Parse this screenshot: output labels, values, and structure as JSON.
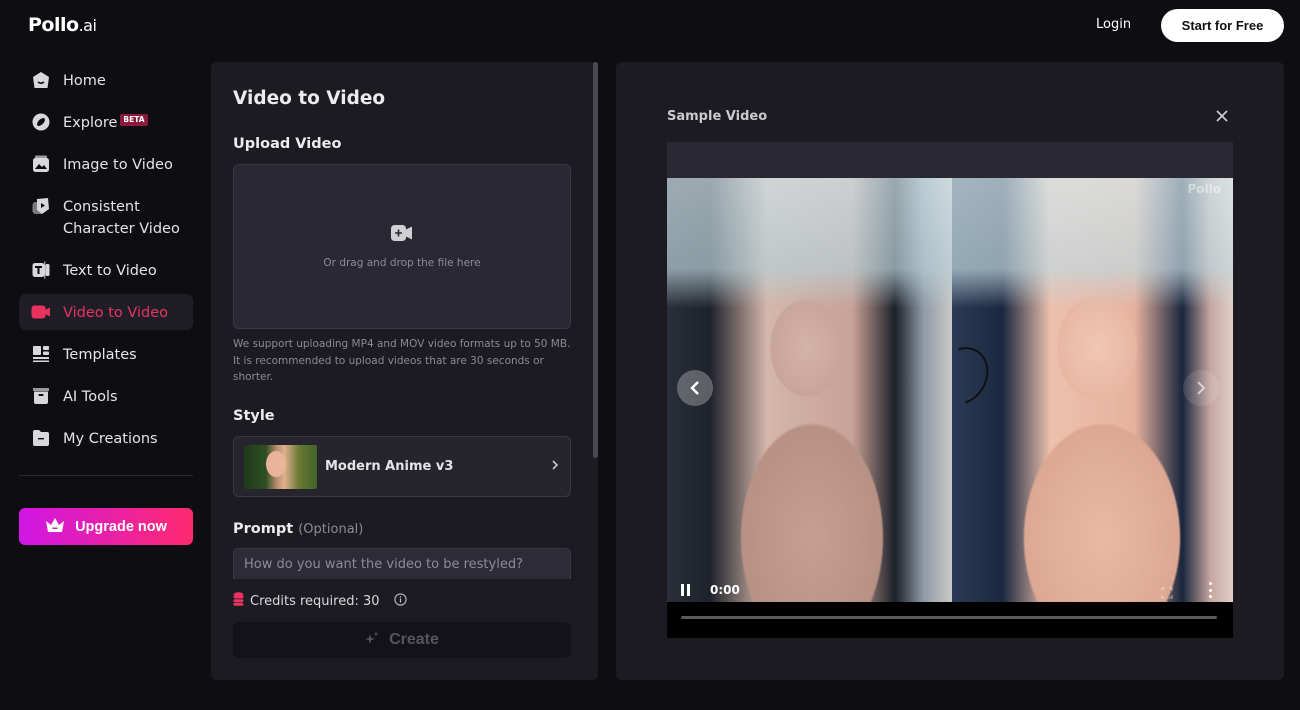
{
  "header": {
    "logo_main": "Pollo",
    "logo_sub": ".ai",
    "login_label": "Login",
    "start_label": "Start for Free"
  },
  "sidebar": {
    "items": [
      {
        "label": "Home",
        "icon": "home-icon"
      },
      {
        "label": "Explore",
        "icon": "compass-icon",
        "badge": "BETA"
      },
      {
        "label": "Image to Video",
        "icon": "image-icon"
      },
      {
        "label": "Consistent Character Video",
        "icon": "character-icon"
      },
      {
        "label": "Text to Video",
        "icon": "text-icon"
      },
      {
        "label": "Video to Video",
        "icon": "video-camera-icon",
        "active": true
      },
      {
        "label": "Templates",
        "icon": "templates-icon"
      },
      {
        "label": "AI Tools",
        "icon": "toolbox-icon"
      },
      {
        "label": "My Creations",
        "icon": "folder-icon"
      }
    ],
    "upgrade_label": "Upgrade now"
  },
  "colors": {
    "accent": "#e8335f",
    "upgrade_gradient_start": "#d016e6",
    "upgrade_gradient_end": "#ff2a6d",
    "background": "#0e0d12",
    "panel": "#1c1b22"
  },
  "main": {
    "title": "Video to Video",
    "upload": {
      "label": "Upload Video",
      "drop_text": "Or drag and drop the file here",
      "note": "We support uploading MP4 and MOV video formats up to 50 MB. It is recommended to upload videos that are 30 seconds or shorter."
    },
    "style": {
      "label": "Style",
      "selected": "Modern Anime v3"
    },
    "prompt": {
      "label": "Prompt",
      "optional": "(Optional)",
      "value": "",
      "placeholder": "How do you want the video to be restyled?"
    },
    "credits_text": "Credits required: 30",
    "create_label": "Create"
  },
  "sample": {
    "title": "Sample Video",
    "watermark": "Pollo",
    "time": "0:00",
    "progress": 0
  }
}
